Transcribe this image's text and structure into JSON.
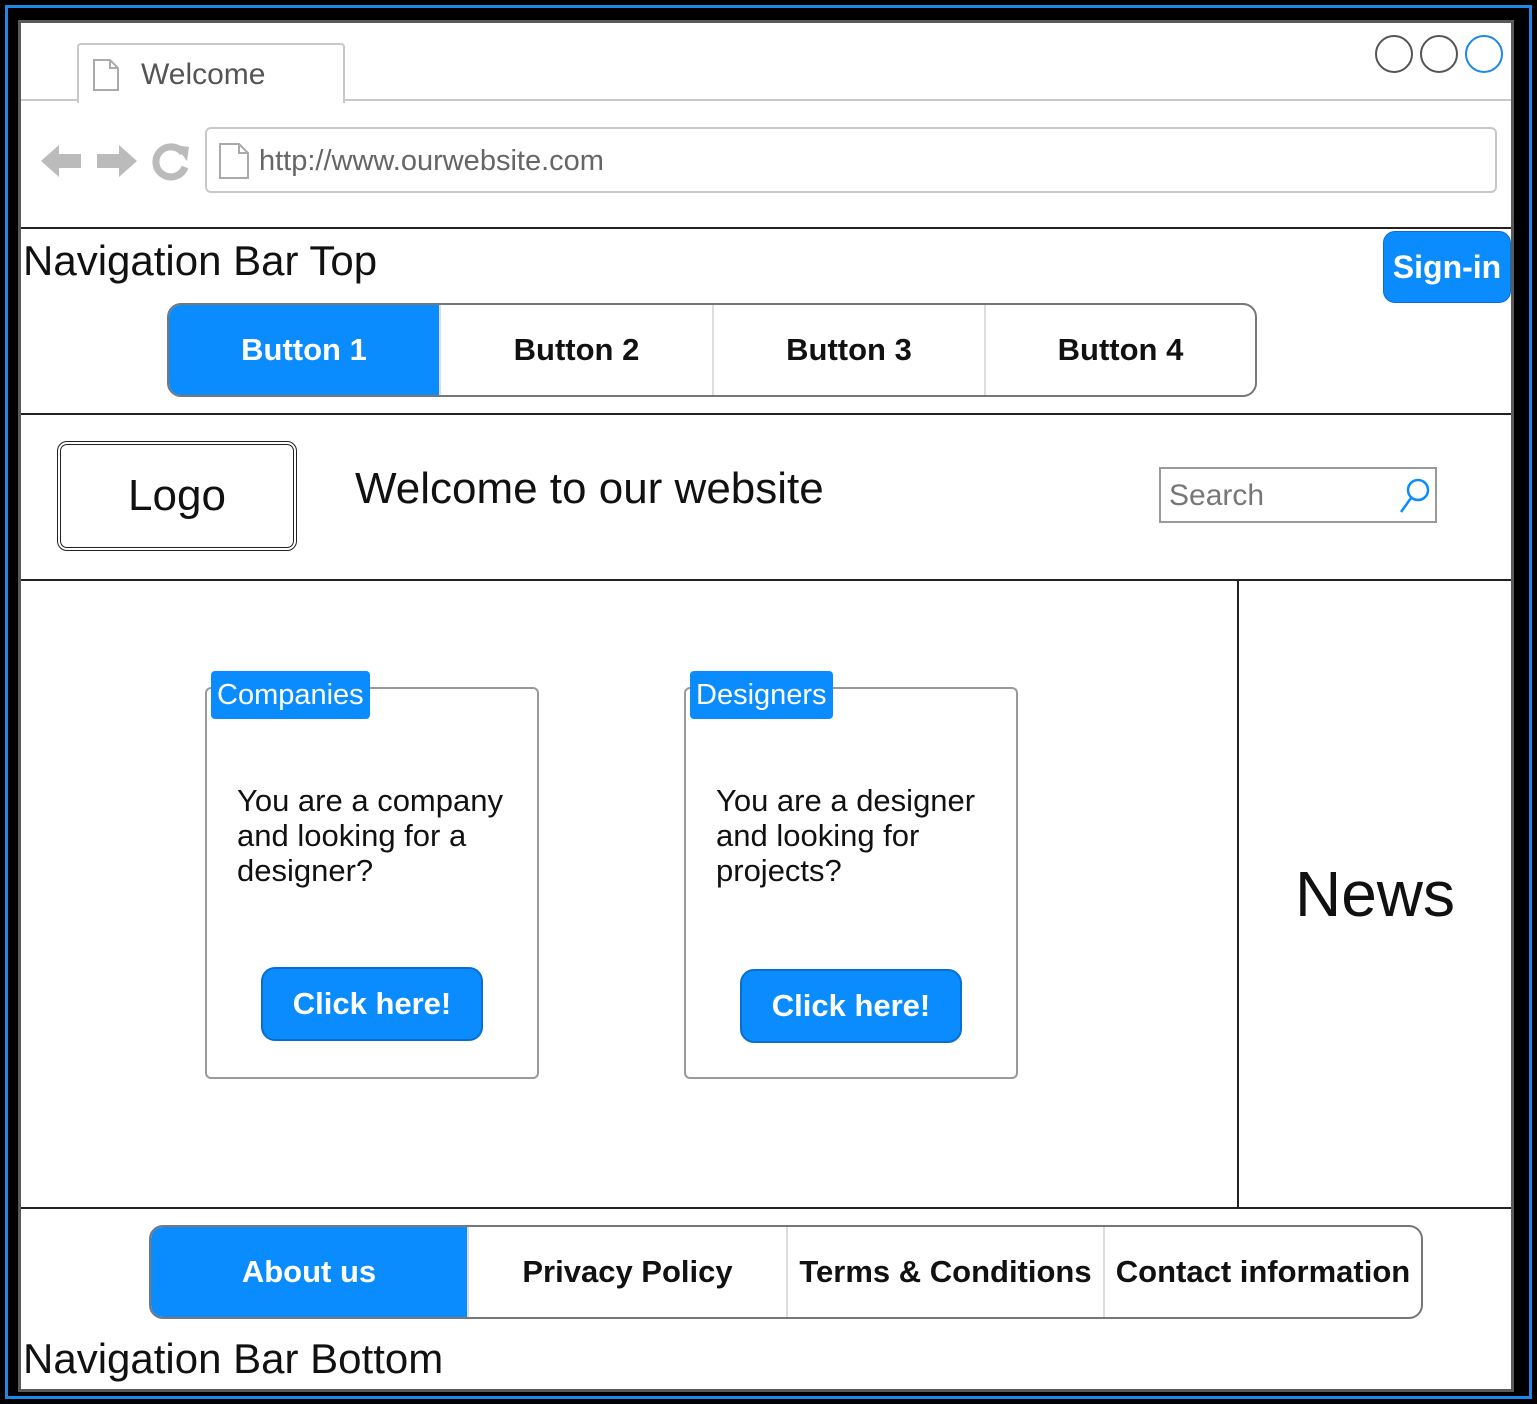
{
  "browser": {
    "tab_title": "Welcome",
    "url": "http://www.ourwebsite.com",
    "window_buttons": [
      "minimize",
      "maximize",
      "close"
    ],
    "nav_icons": [
      "back-arrow-icon",
      "forward-arrow-icon",
      "reload-icon"
    ]
  },
  "nav_top": {
    "label": "Navigation Bar Top",
    "signin_label": "Sign-in",
    "buttons": [
      "Button 1",
      "Button 2",
      "Button 3",
      "Button 4"
    ],
    "active_index": 0
  },
  "header": {
    "logo_label": "Logo",
    "welcome_text": "Welcome to our website",
    "search_placeholder": "Search"
  },
  "cards": [
    {
      "badge": "Companies",
      "text": "You are a company and looking for a designer?",
      "button": "Click here!"
    },
    {
      "badge": "Designers",
      "text": "You are a designer and looking for projects?",
      "button": "Click here!"
    }
  ],
  "news": {
    "title": "News"
  },
  "nav_bottom": {
    "label": "Navigation Bar Bottom",
    "links": [
      "About us",
      "Privacy Policy",
      "Terms & Conditions",
      "Contact information"
    ],
    "active_index": 0
  },
  "colors": {
    "accent": "#0a8cff",
    "frame": "#1e88e5"
  }
}
